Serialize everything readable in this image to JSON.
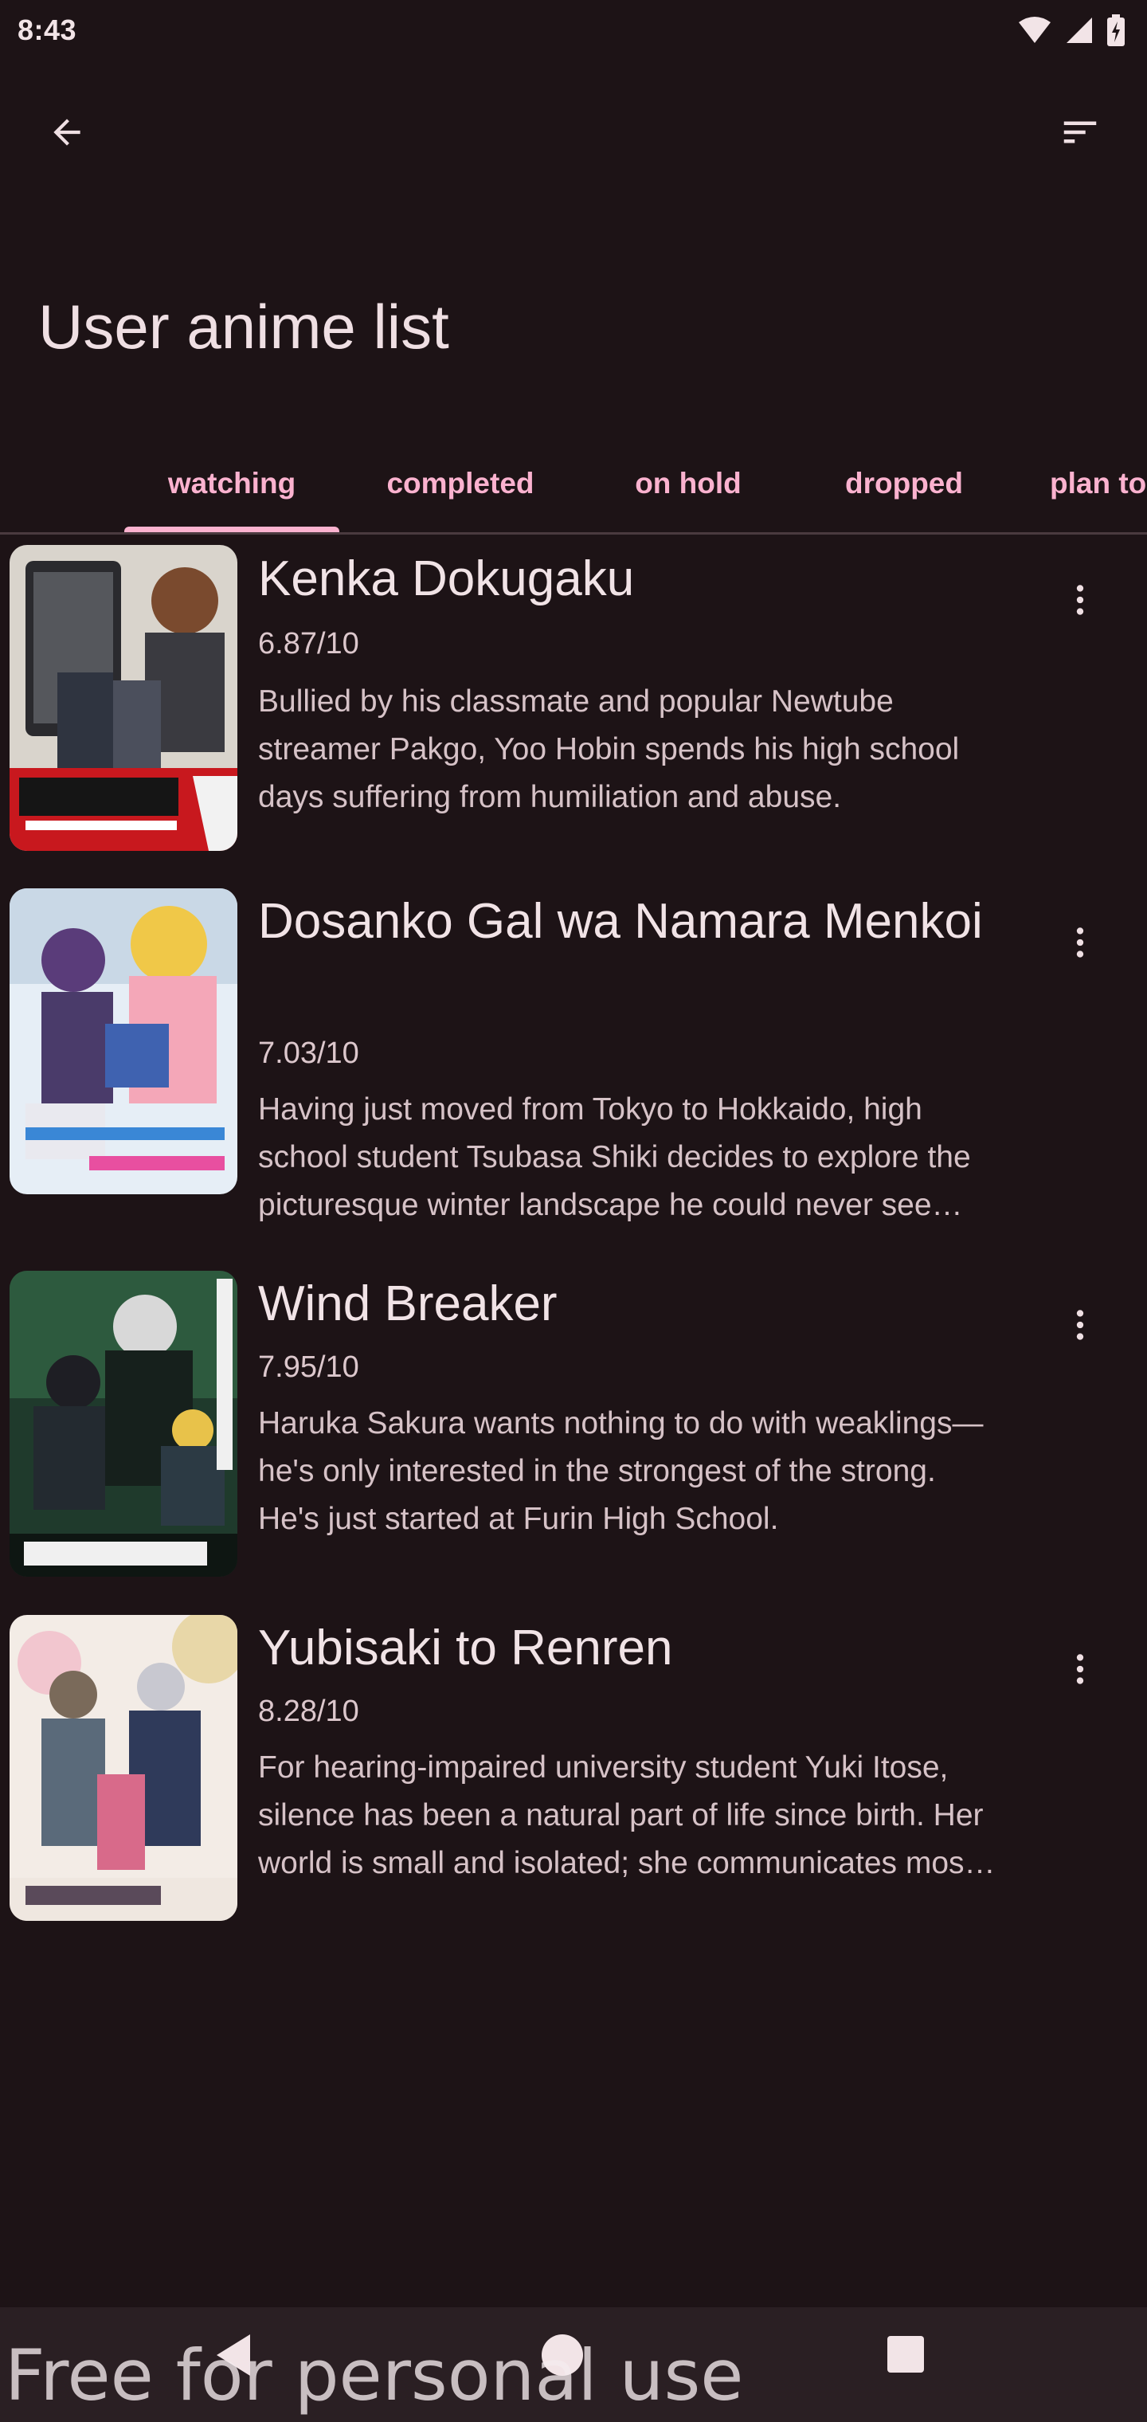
{
  "status_bar": {
    "time": "8:43",
    "icons": [
      "wifi-icon",
      "signal-icon",
      "battery-charging-icon"
    ]
  },
  "app_bar": {
    "back_icon": "arrow-back-icon",
    "sort_icon": "sort-icon"
  },
  "page": {
    "title": "User anime list"
  },
  "tabs": [
    {
      "label": "watching",
      "selected": true
    },
    {
      "label": "completed",
      "selected": false
    },
    {
      "label": "on hold",
      "selected": false
    },
    {
      "label": "dropped",
      "selected": false
    },
    {
      "label": "plan to",
      "selected": false
    }
  ],
  "anime": [
    {
      "title": "Kenka Dokugaku",
      "score": "6.87/10",
      "synopsis": "Bullied by his classmate and popular Newtube streamer Pakgo, Yoo Hobin spends his high school days suffering from humiliation and abuse."
    },
    {
      "title": "Dosanko Gal wa Namara Menkoi",
      "score": "7.03/10",
      "synopsis": "Having just moved from Tokyo to Hokkaido, high school student Tsubasa Shiki decides to explore the picturesque winter landscape he could never see before."
    },
    {
      "title": "Wind Breaker",
      "score": "7.95/10",
      "synopsis": "Haruka Sakura wants nothing to do with weaklings—he's only interested in the strongest of the strong. He's just started at Furin High School."
    },
    {
      "title": "Yubisaki to Renren",
      "score": "8.28/10",
      "synopsis": "For hearing-impaired university student Yuki Itose, silence has been a natural part of life since birth. Her world is small and isolated; she communicates mostly in sign language."
    }
  ],
  "colors": {
    "background": "#1d1316",
    "accent": "#fbb2cf",
    "text": "#efdfe3"
  },
  "watermark": "Free for personal use"
}
